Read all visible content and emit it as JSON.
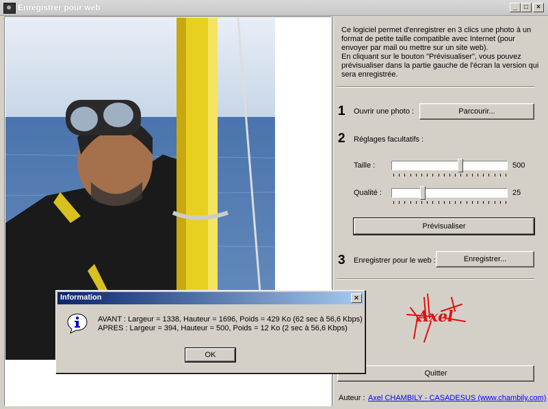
{
  "window": {
    "title": "Enregistrer pour web",
    "buttons": {
      "minimize": "_",
      "maximize": "□",
      "close": "×"
    }
  },
  "info_text": [
    "Ce logiciel permet d'enregistrer en 3 clics une photo à un",
    "format de petite taille compatible avec Internet (pour",
    "envoyer par mail ou mettre sur un site web).",
    "En cliquant sur le bouton \"Prévisualiser\", vous pouvez",
    "prévisualiser dans la partie gauche de l'écran la version qui",
    "sera enregistrée."
  ],
  "step1": {
    "number": "1",
    "label": "Ouvrir une photo :",
    "button": "Parcourir..."
  },
  "step2": {
    "number": "2",
    "label": "Réglages facultatifs :"
  },
  "taille": {
    "label": "Taille :",
    "value": "500",
    "fraction": 0.6
  },
  "qualite": {
    "label": "Qualité :",
    "value": "25",
    "fraction": 0.25
  },
  "preview_button": "Prévisualiser",
  "step3": {
    "number": "3",
    "label": "Enregistrer pour le web :",
    "button": "Enregistrer..."
  },
  "logo_text": "Axel",
  "quit_button": "Quitter",
  "author": {
    "label": "Auteur :",
    "link": "Axel CHAMBILY - CASADESUS (www.chambily.com)"
  },
  "dialog": {
    "title": "Information",
    "line1": "AVANT : Largeur = 1338, Hauteur = 1696, Poids = 429 Ko (62 sec à 56,6 Kbps)",
    "line2": "APRES : Largeur = 394, Hauteur = 500, Poids = 12 Ko (2 sec à 56,6 Kbps)",
    "ok": "OK",
    "close": "×",
    "icon": "info-icon"
  },
  "colors": {
    "titlebar_active": "#0a246a",
    "logo": "#e01010",
    "link": "#0000ff"
  }
}
